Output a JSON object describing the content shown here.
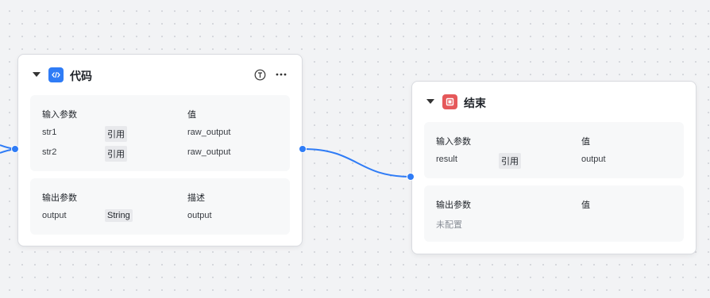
{
  "colors": {
    "accent": "#2f7cf6",
    "end_icon": "#e5585a"
  },
  "code_node": {
    "title": "代码",
    "icon": "code-icon",
    "inputs": {
      "header": {
        "name": "输入参数",
        "value": "值"
      },
      "rows": [
        {
          "name": "str1",
          "type": "引用",
          "value": "raw_output"
        },
        {
          "name": "str2",
          "type": "引用",
          "value": "raw_output"
        }
      ]
    },
    "outputs": {
      "header": {
        "name": "输出参数",
        "desc": "描述"
      },
      "rows": [
        {
          "name": "output",
          "type": "String",
          "desc": "output"
        }
      ]
    }
  },
  "end_node": {
    "title": "结束",
    "icon": "stop-icon",
    "inputs": {
      "header": {
        "name": "输入参数",
        "value": "值"
      },
      "rows": [
        {
          "name": "result",
          "type": "引用",
          "value": "output"
        }
      ]
    },
    "outputs": {
      "header": {
        "name": "输出参数",
        "value": "值"
      },
      "empty": "未配置"
    }
  }
}
